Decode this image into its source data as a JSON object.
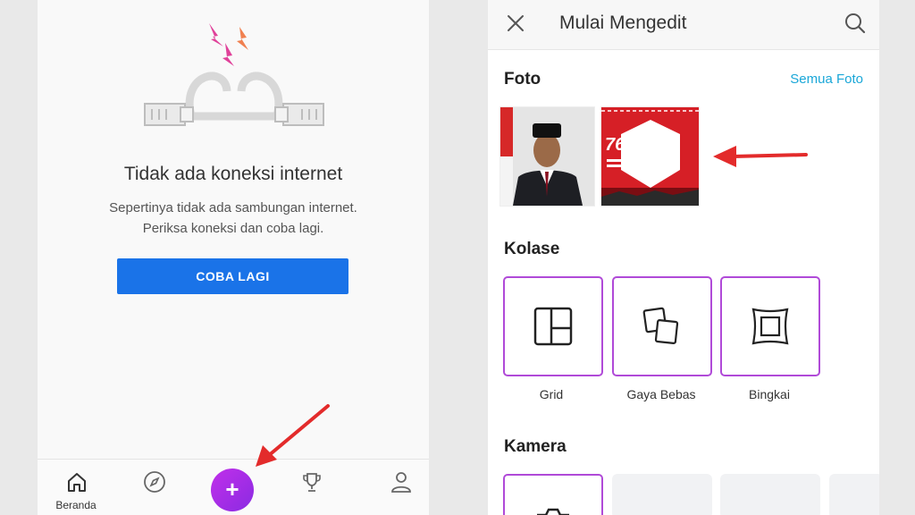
{
  "left_screen": {
    "error_title": "Tidak ada koneksi internet",
    "error_line1": "Sepertinya tidak ada sambungan internet.",
    "error_line2": "Periksa koneksi dan coba lagi.",
    "retry_button": "COBA LAGI",
    "nav": {
      "home_label": "Beranda",
      "fab_symbol": "+"
    },
    "icons": [
      "disconnected-cable-icon",
      "home-icon",
      "compass-icon",
      "trophy-icon",
      "profile-icon"
    ],
    "colors": {
      "primary": "#1a73e8",
      "fab": "#b52de0",
      "arrow": "#e32b2b"
    }
  },
  "right_screen": {
    "title": "Mulai Mengedit",
    "photos_section": "Foto",
    "all_photos_link": "Semua Foto",
    "collage_section": "Kolase",
    "collage_items": [
      "Grid",
      "Gaya Bebas",
      "Bingkai"
    ],
    "camera_section": "Kamera",
    "icons": [
      "close-icon",
      "search-icon",
      "grid-layout-icon",
      "freestyle-icon",
      "frame-icon",
      "camera-icon"
    ],
    "colors": {
      "accent": "#1aa7d8",
      "tile_border": "#b04ad8"
    }
  }
}
